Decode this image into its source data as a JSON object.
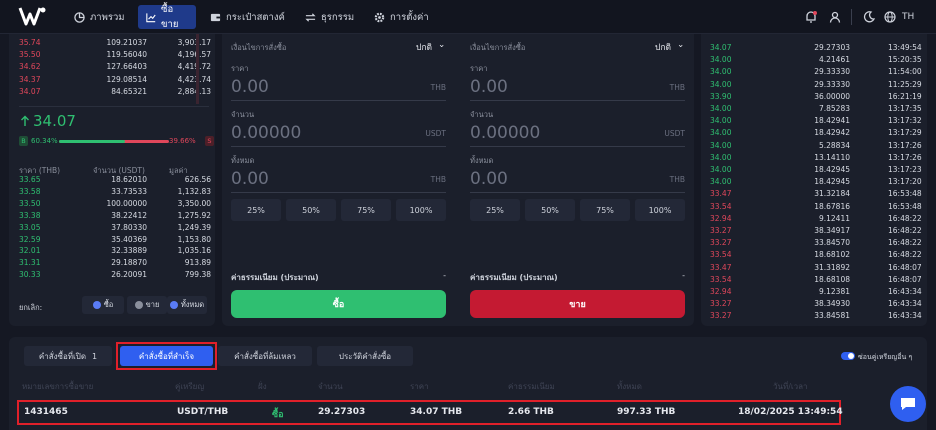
{
  "nav": {
    "items": [
      "ภาพรวม",
      "ซื้อขาย",
      "กระเป๋าสตางค์",
      "ธุรกรรม",
      "การตั้งค่า"
    ],
    "language": "TH"
  },
  "orderbook": {
    "asks": [
      {
        "price": "35.74",
        "amount": "109.21037",
        "total": "3,903.17"
      },
      {
        "price": "35.50",
        "amount": "119.56040",
        "total": "4,196.57"
      },
      {
        "price": "34.62",
        "amount": "127.66403",
        "total": "4,419.72"
      },
      {
        "price": "34.37",
        "amount": "129.08514",
        "total": "4,423.74"
      },
      {
        "price": "34.07",
        "amount": "84.65321",
        "total": "2,884.13"
      }
    ],
    "last_price": "34.07",
    "buy_ratio": "B 60.34%",
    "sell_ratio": "39.66% S",
    "buy_fraction": 0.6034,
    "col_price": "ราคา (THB)",
    "col_amount": "จำนวน (USDT)",
    "col_total": "มูลค่า",
    "bids": [
      {
        "price": "33.65",
        "amount": "18.62010",
        "total": "626.56"
      },
      {
        "price": "33.58",
        "amount": "33.73533",
        "total": "1,132.83"
      },
      {
        "price": "33.50",
        "amount": "100.00000",
        "total": "3,350.00"
      },
      {
        "price": "33.38",
        "amount": "38.22412",
        "total": "1,275.92"
      },
      {
        "price": "33.05",
        "amount": "37.80330",
        "total": "1,249.39"
      },
      {
        "price": "32.59",
        "amount": "35.40369",
        "total": "1,153.80"
      },
      {
        "price": "32.01",
        "amount": "32.33889",
        "total": "1,035.16"
      },
      {
        "price": "31.31",
        "amount": "29.18870",
        "total": "913.89"
      },
      {
        "price": "30.33",
        "amount": "26.20091",
        "total": "799.38"
      }
    ],
    "cancel_label": "ยกเลิก:",
    "cancel_buy": "ซื้อ",
    "cancel_sell": "ขาย",
    "cancel_all": "ทั้งหมด"
  },
  "buy_form": {
    "condition_label": "เงื่อนไขการสั่งซื้อ",
    "condition_value": "ปกติ",
    "price_label": "ราคา",
    "price_value": "0.00",
    "price_unit": "THB",
    "amount_label": "จำนวน",
    "amount_value": "0.00000",
    "amount_unit": "USDT",
    "total_label": "ทั้งหมด",
    "total_value": "0.00",
    "total_unit": "THB",
    "pcts": [
      "25%",
      "50%",
      "75%",
      "100%"
    ],
    "fee_label": "ค่าธรรมเนียม (ประมาณ)",
    "fee_value": "-",
    "button": "ซื้อ"
  },
  "sell_form": {
    "condition_label": "เงื่อนไขการสั่งซื้อ",
    "condition_value": "ปกติ",
    "price_label": "ราคา",
    "price_value": "0.00",
    "price_unit": "THB",
    "amount_label": "จำนวน",
    "amount_value": "0.00000",
    "amount_unit": "USDT",
    "total_label": "ทั้งหมด",
    "total_value": "0.00",
    "total_unit": "THB",
    "pcts": [
      "25%",
      "50%",
      "75%",
      "100%"
    ],
    "fee_label": "ค่าธรรมเนียม (ประมาณ)",
    "fee_value": "-",
    "button": "ขาย"
  },
  "trades": [
    {
      "price": "34.07",
      "amount": "29.27303",
      "time": "13:49:54",
      "side": "buy"
    },
    {
      "price": "34.00",
      "amount": "4.21461",
      "time": "15:20:35",
      "side": "buy"
    },
    {
      "price": "34.00",
      "amount": "29.33330",
      "time": "11:54:00",
      "side": "buy"
    },
    {
      "price": "34.00",
      "amount": "29.33330",
      "time": "11:25:29",
      "side": "buy"
    },
    {
      "price": "33.90",
      "amount": "36.00000",
      "time": "16:21:19",
      "side": "buy"
    },
    {
      "price": "34.00",
      "amount": "7.85283",
      "time": "13:17:35",
      "side": "buy"
    },
    {
      "price": "34.00",
      "amount": "18.42941",
      "time": "13:17:32",
      "side": "buy"
    },
    {
      "price": "34.00",
      "amount": "18.42942",
      "time": "13:17:29",
      "side": "buy"
    },
    {
      "price": "34.00",
      "amount": "5.28834",
      "time": "13:17:26",
      "side": "buy"
    },
    {
      "price": "34.00",
      "amount": "13.14110",
      "time": "13:17:26",
      "side": "buy"
    },
    {
      "price": "34.00",
      "amount": "18.42945",
      "time": "13:17:23",
      "side": "buy"
    },
    {
      "price": "34.00",
      "amount": "18.42945",
      "time": "13:17:20",
      "side": "buy"
    },
    {
      "price": "33.47",
      "amount": "31.32184",
      "time": "16:53:48",
      "side": "sell"
    },
    {
      "price": "33.54",
      "amount": "18.67816",
      "time": "16:53:48",
      "side": "sell"
    },
    {
      "price": "32.94",
      "amount": "9.12411",
      "time": "16:48:22",
      "side": "sell"
    },
    {
      "price": "33.27",
      "amount": "38.34917",
      "time": "16:48:22",
      "side": "sell"
    },
    {
      "price": "33.27",
      "amount": "33.84570",
      "time": "16:48:22",
      "side": "sell"
    },
    {
      "price": "33.54",
      "amount": "18.68102",
      "time": "16:48:22",
      "side": "sell"
    },
    {
      "price": "33.47",
      "amount": "31.31892",
      "time": "16:48:07",
      "side": "sell"
    },
    {
      "price": "33.54",
      "amount": "18.68108",
      "time": "16:48:07",
      "side": "sell"
    },
    {
      "price": "32.94",
      "amount": "9.12381",
      "time": "16:43:34",
      "side": "sell"
    },
    {
      "price": "33.27",
      "amount": "38.34930",
      "time": "16:43:34",
      "side": "sell"
    },
    {
      "price": "33.27",
      "amount": "33.84581",
      "time": "16:43:34",
      "side": "sell"
    }
  ],
  "orders": {
    "tabs": [
      {
        "label": "คำสั่งซื้อที่เปิด",
        "count": "1"
      },
      {
        "label": "คำสั่งซื้อที่สำเร็จ"
      },
      {
        "label": "คำสั่งซื้อที่ล้มเหลว"
      },
      {
        "label": "ประวัติคำสั่งซื้อ"
      }
    ],
    "toggle_label": "ซ่อนคู่เหรียญอื่น ๆ",
    "columns": [
      "หมายเลขการซื้อขาย",
      "คู่เหรียญ",
      "ฝั่ง",
      "จำนวน",
      "ราคา",
      "ค่าธรรมเนียม",
      "ทั้งหมด",
      "วันที่/เวลา"
    ],
    "row": {
      "id": "1431465",
      "pair": "USDT/THB",
      "side": "ซื้อ",
      "amount": "29.27303",
      "price": "34.07 THB",
      "fee": "2.66 THB",
      "total": "997.33 THB",
      "datetime": "18/02/2025 13:49:54"
    }
  },
  "colors": {
    "accent": "#2f5ff0",
    "buy": "#2fbf71",
    "sell": "#e0475b",
    "highlight": "#e0202a"
  }
}
